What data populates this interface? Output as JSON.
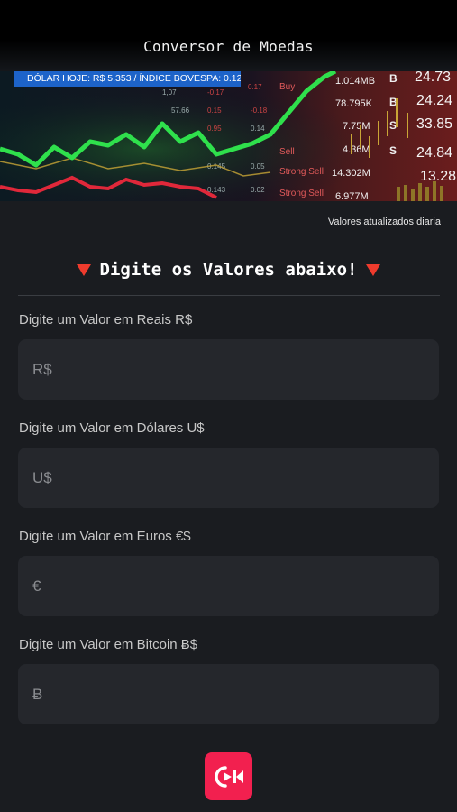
{
  "header": {
    "title": "Conversor de Moedas"
  },
  "banner": {
    "ticker": "DÓLAR HOJE: R$ 5.353 / ÍNDICE BOVESPA: 0.12"
  },
  "update_note": "Valores atualizados diaria",
  "section": {
    "heading": "Digite os Valores abaixo!"
  },
  "fields": [
    {
      "label": "Digite um Valor em Reais R$",
      "placeholder": "R$",
      "value": ""
    },
    {
      "label": "Digite um Valor em Dólares U$",
      "placeholder": "U$",
      "value": ""
    },
    {
      "label": "Digite um Valor em Euros €$",
      "placeholder": "€",
      "value": ""
    },
    {
      "label": "Digite um Valor em Bitcoin Ƀ$",
      "placeholder": "Ƀ",
      "value": ""
    }
  ],
  "colors": {
    "background": "#1a1c20",
    "input_bg": "#25272c",
    "accent_red": "#ef3b2d",
    "ticker_blue": "#1d63c9",
    "logo_pink": "#f2204f"
  },
  "icons": {
    "section_marker": "red-down-triangle-icon",
    "logo": "video-camera-logo-icon"
  }
}
